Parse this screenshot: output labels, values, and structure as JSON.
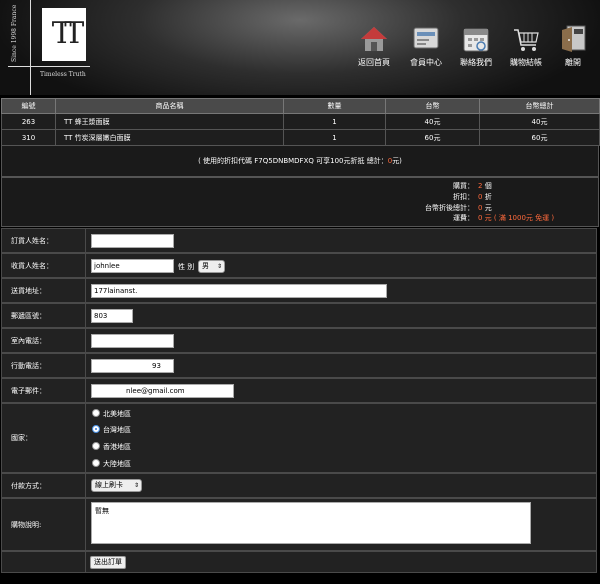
{
  "brand": {
    "since": "Since 1998 France",
    "mark": "TT",
    "tagline": "Timeless Truth"
  },
  "nav": [
    {
      "label": "返回首頁",
      "icon": "home-icon"
    },
    {
      "label": "會員中心",
      "icon": "member-card-icon"
    },
    {
      "label": "聯絡我們",
      "icon": "calendar-icon"
    },
    {
      "label": "購物結帳",
      "icon": "shopping-cart-icon"
    },
    {
      "label": "離開",
      "icon": "exit-icon"
    }
  ],
  "table": {
    "headers": [
      "編號",
      "商品名稱",
      "數量",
      "台幣",
      "台幣總計"
    ],
    "rows": [
      {
        "id": "263",
        "name": "TT 蜂王漿面膜",
        "qty": "1",
        "price": "40元",
        "total": "40元"
      },
      {
        "id": "310",
        "name": "TT 竹炭深層嫩白面膜",
        "qty": "1",
        "price": "60元",
        "total": "60元"
      }
    ]
  },
  "discount": {
    "text": "( 使用的折扣代碼 F7Q5DNBMDFXQ 可享100元折抵  總計：",
    "amount": "0",
    "suffix": "元)"
  },
  "summary": [
    {
      "label": "購買：",
      "value": "2",
      "unit": " 個"
    },
    {
      "label": "折扣：",
      "value": "0",
      "unit": " 折"
    },
    {
      "label": "台幣折後總計：",
      "value": "0",
      "unit": " 元"
    },
    {
      "label": "運費：",
      "value": "0 元 ( 滿 1000元 免運 )",
      "unit": ""
    }
  ],
  "form": {
    "orderer_label": "訂貨人姓名：",
    "orderer_value": "",
    "receiver_label": "收貨人姓名：",
    "receiver_value": "johnlee",
    "gender_label": "性 別",
    "gender_value": "男",
    "address_label": "送貨地址：",
    "address_value": "177lainanst.",
    "zip_label": "郵遞區號：",
    "zip_value": "803",
    "phone_label": "室內電話：",
    "phone_value": "",
    "mobile_label": "行動電話：",
    "mobile_value": "93",
    "email_label": "電子郵件：",
    "email_value": "nlee@gmail.com",
    "country_label": "國家：",
    "countries": [
      "北美地區",
      "台灣地區",
      "香港地區",
      "大陸地區"
    ],
    "country_selected": "台灣地區",
    "payment_label": "付款方式：",
    "payment_value": "線上刷卡",
    "note_label": "購物說明:",
    "note_value": "暫無",
    "submit_label": "送出訂單"
  }
}
